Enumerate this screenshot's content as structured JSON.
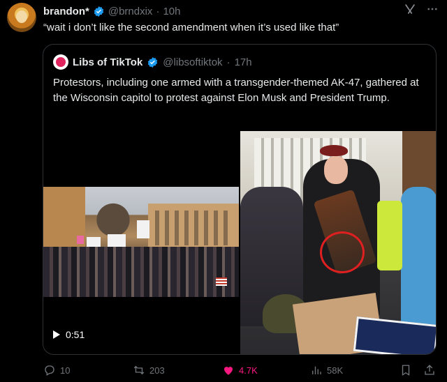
{
  "post": {
    "author_name": "brandon*",
    "author_handle": "@brndxix",
    "separator": "·",
    "time": "10h",
    "text": "“wait i don’t like the second amendment when it’s used like that”"
  },
  "quoted_post": {
    "author_name": "Libs of TikTok",
    "author_handle": "@libsoftiktok",
    "separator": "·",
    "time": "17h",
    "text": "Protestors, including one armed with a transgender-themed AK-47, gathered at the Wisconsin capitol to protest against Elon Musk and President Trump.",
    "video_duration": "0:51"
  },
  "actions": {
    "replies": "10",
    "reposts": "203",
    "likes": "4.7K",
    "views": "58K"
  },
  "colors": {
    "background": "#000000",
    "text": "#e7e9ea",
    "muted": "#71767b",
    "like_active": "#f91880",
    "verified": "#1d9bf0",
    "annotation_circle": "#e02020"
  },
  "icons": [
    "grok-icon",
    "more-icon",
    "verified-icon",
    "play-icon",
    "reply-icon",
    "repost-icon",
    "like-icon",
    "views-icon",
    "bookmark-icon",
    "share-icon"
  ]
}
